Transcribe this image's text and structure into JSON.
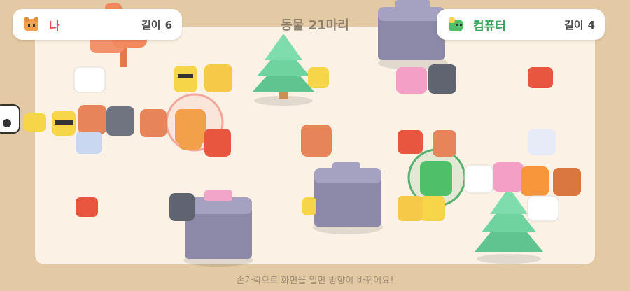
{
  "hud": {
    "player": {
      "name": "나",
      "length_label": "길이",
      "length_value": "6",
      "color": "#e2504c"
    },
    "computer": {
      "name": "컴퓨터",
      "length_label": "길이",
      "length_value": "4",
      "color": "#3ba55a"
    },
    "animal_count": "동물 21마리"
  },
  "hint": "손가락으로 화면을 밀면 방향이 바뀌어요!",
  "colors": {
    "background": "#e4c9a5",
    "arena": "#fbf2e5",
    "player_ring": "#f08a82",
    "computer_ring": "#3aa65a",
    "tree": "#6fd39f",
    "rock": "#8c88a8"
  }
}
